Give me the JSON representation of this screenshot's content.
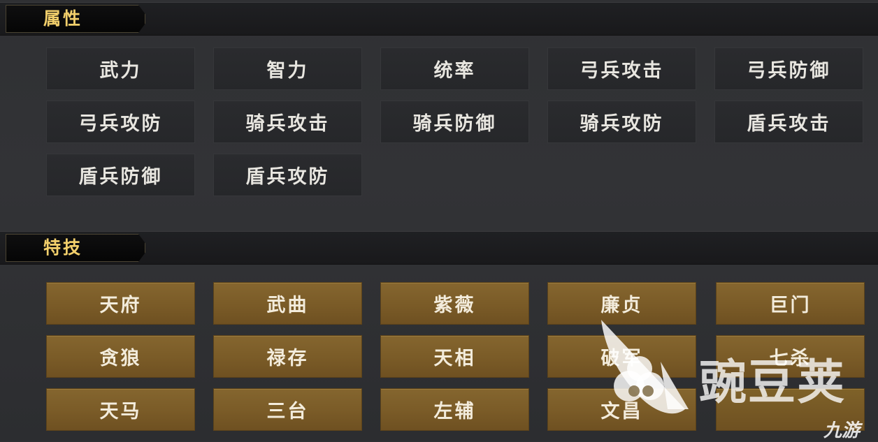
{
  "attributes": {
    "title": "属性",
    "items": [
      "武力",
      "智力",
      "统率",
      "弓兵攻击",
      "弓兵防御",
      "弓兵攻防",
      "骑兵攻击",
      "骑兵防御",
      "骑兵攻防",
      "盾兵攻击",
      "盾兵防御",
      "盾兵攻防"
    ]
  },
  "skills": {
    "title": "特技",
    "items": [
      "天府",
      "武曲",
      "紫薇",
      "廉贞",
      "巨门",
      "贪狼",
      "禄存",
      "天相",
      "破军",
      "七杀",
      "天马",
      "三台",
      "左辅",
      "文昌",
      ""
    ]
  },
  "watermark": {
    "brand": "豌豆荚",
    "sub": "九游"
  },
  "colors": {
    "title_gold": "#f2cf6b",
    "skill_tile": "#7a5b27",
    "attr_tile": "#26272a"
  }
}
